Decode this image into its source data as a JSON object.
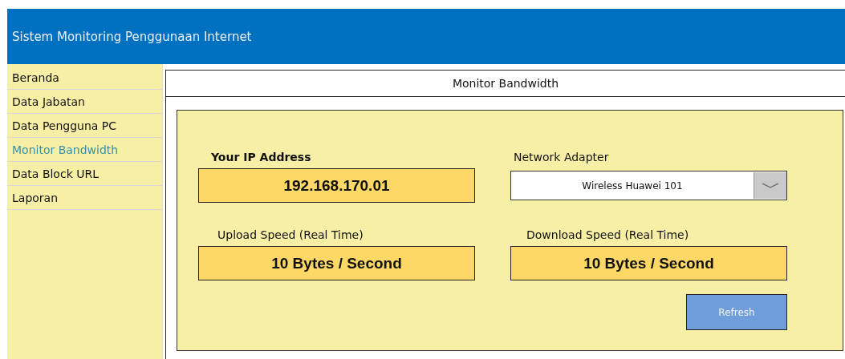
{
  "header": {
    "title": "Sistem Monitoring Penggunaan Internet"
  },
  "sidebar": {
    "items": [
      {
        "label": "Beranda",
        "selected": false
      },
      {
        "label": "Data Jabatan",
        "selected": false
      },
      {
        "label": "Data Pengguna PC",
        "selected": false
      },
      {
        "label": "Monitor Bandwidth",
        "selected": true
      },
      {
        "label": "Data Block URL",
        "selected": false
      },
      {
        "label": "Laporan",
        "selected": false
      }
    ]
  },
  "panel": {
    "title": "Monitor Bandwidth",
    "ip": {
      "label": "Your IP Address",
      "value": "192.168.170.01"
    },
    "adapter": {
      "label": "Network Adapter",
      "value": "Wireless Huawei 101"
    },
    "upload": {
      "label": "Upload Speed (Real Time)",
      "value": "10 Bytes / Second"
    },
    "download": {
      "label": "Download Speed (Real Time)",
      "value": "10 Bytes / Second"
    },
    "button": "Refresh"
  }
}
